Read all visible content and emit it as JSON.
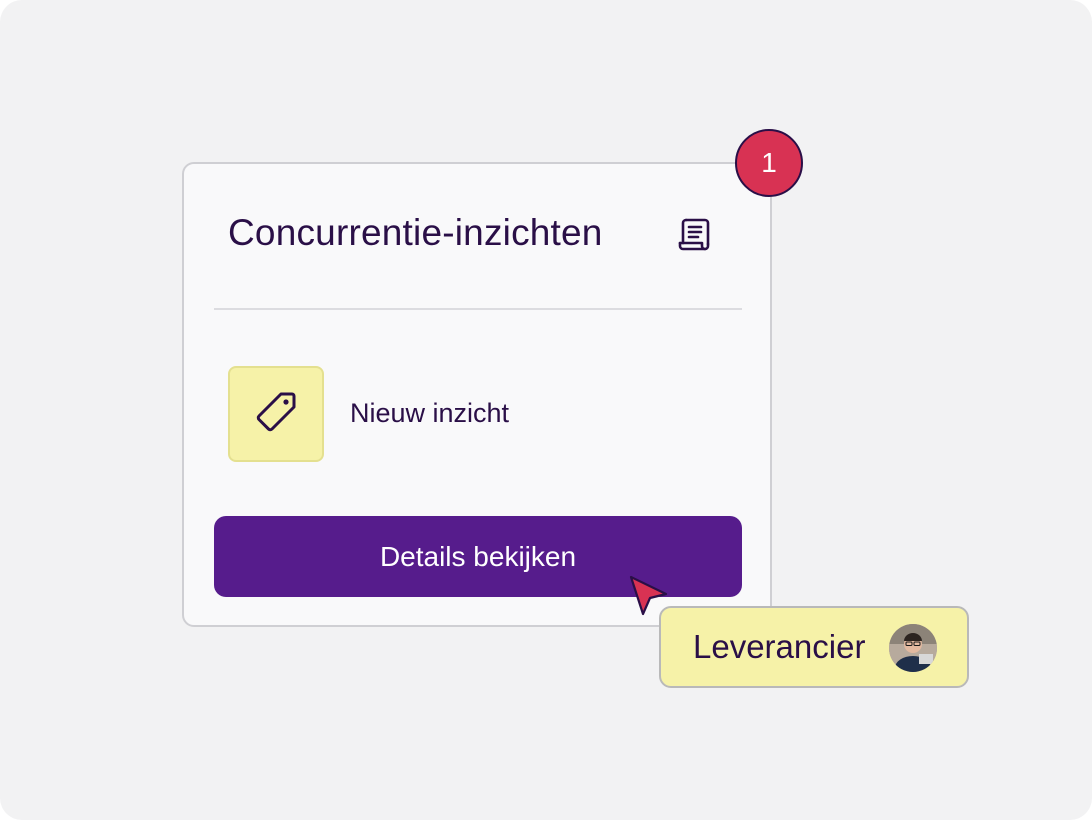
{
  "card": {
    "title": "Concurrentie-inzichten",
    "title_icon": "document-icon",
    "insight": {
      "icon": "tag-icon",
      "label": "Nieuw inzicht"
    },
    "action_button_label": "Details bekijken"
  },
  "notification_badge": {
    "count": "1"
  },
  "user_chip": {
    "name": "Leverancier",
    "avatar": "avatar-photo"
  },
  "colors": {
    "primary_purple": "#561c8c",
    "dark_text": "#2a0f47",
    "badge_red": "#d83253",
    "highlight_yellow": "#f6f2a8",
    "background": "#f2f2f3",
    "card_background": "#f9f9fa"
  }
}
